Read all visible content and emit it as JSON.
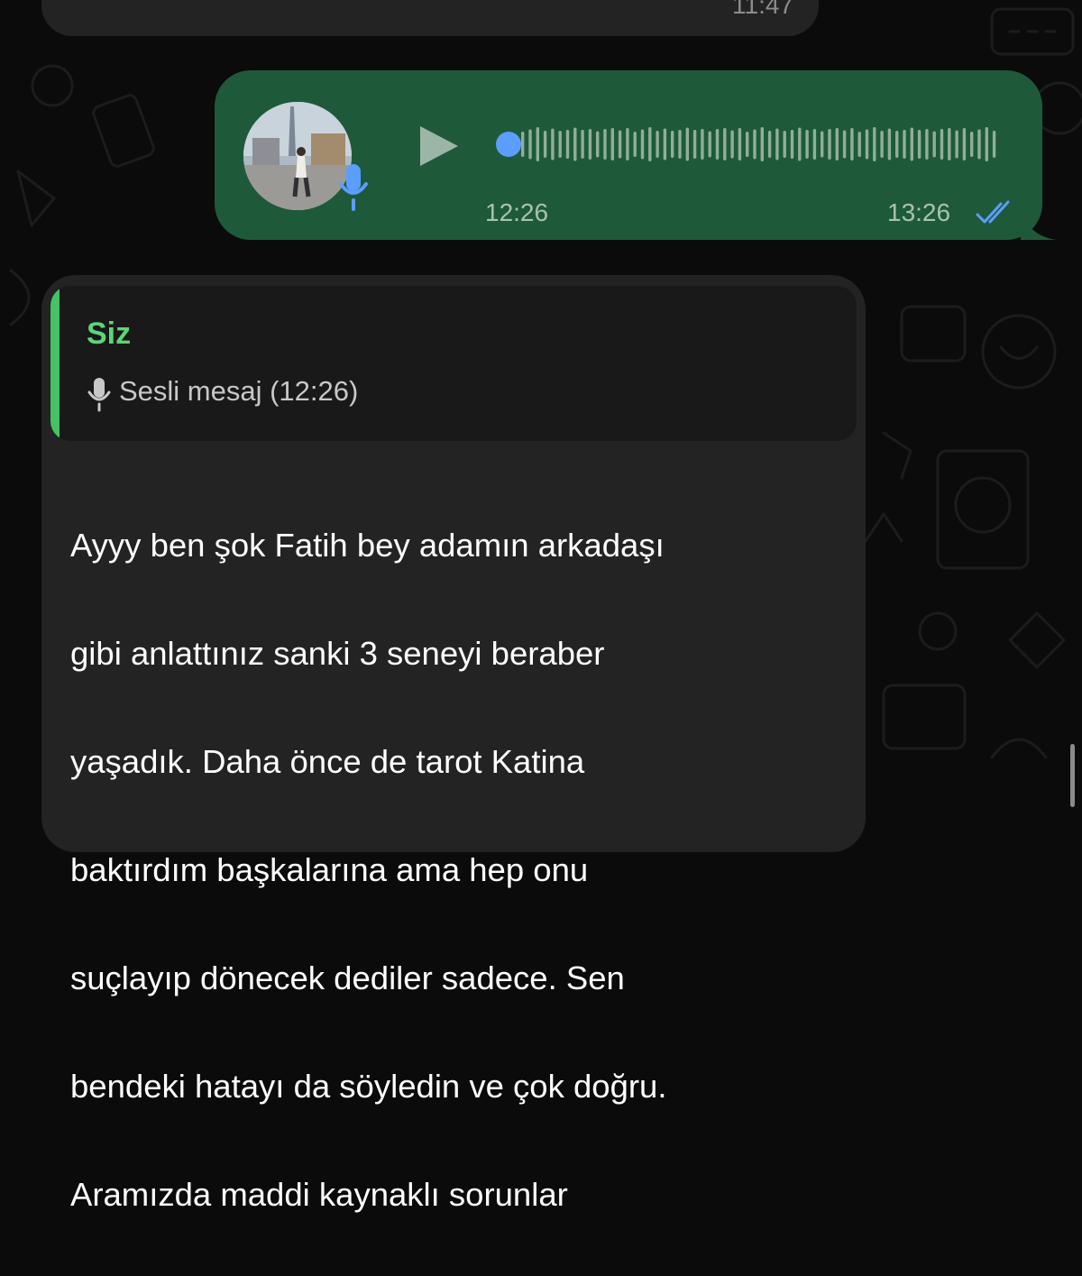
{
  "previous_message": {
    "time": "11:47"
  },
  "voice_message": {
    "duration": "12:26",
    "time": "13:26",
    "status": "read",
    "accent_color": "#5b9eff",
    "bubble_color": "#1e5a3a"
  },
  "reply_message": {
    "quoted": {
      "author": "Siz",
      "text": "Sesli mesaj (12:26)",
      "icon": "mic-icon"
    },
    "lines": [
      "Ayyy ben şok Fatih bey adamın arkadaşı",
      "gibi anlattınız sanki 3 seneyi beraber",
      "yaşadık. Daha önce de tarot Katina",
      "baktırdım başkalarına ama hep onu",
      "suçlayıp dönecek dediler sadece. Sen",
      "bendeki hatayı da söyledin ve çok doğru.",
      "Aramızda maddi kaynaklı sorunlar"
    ]
  }
}
